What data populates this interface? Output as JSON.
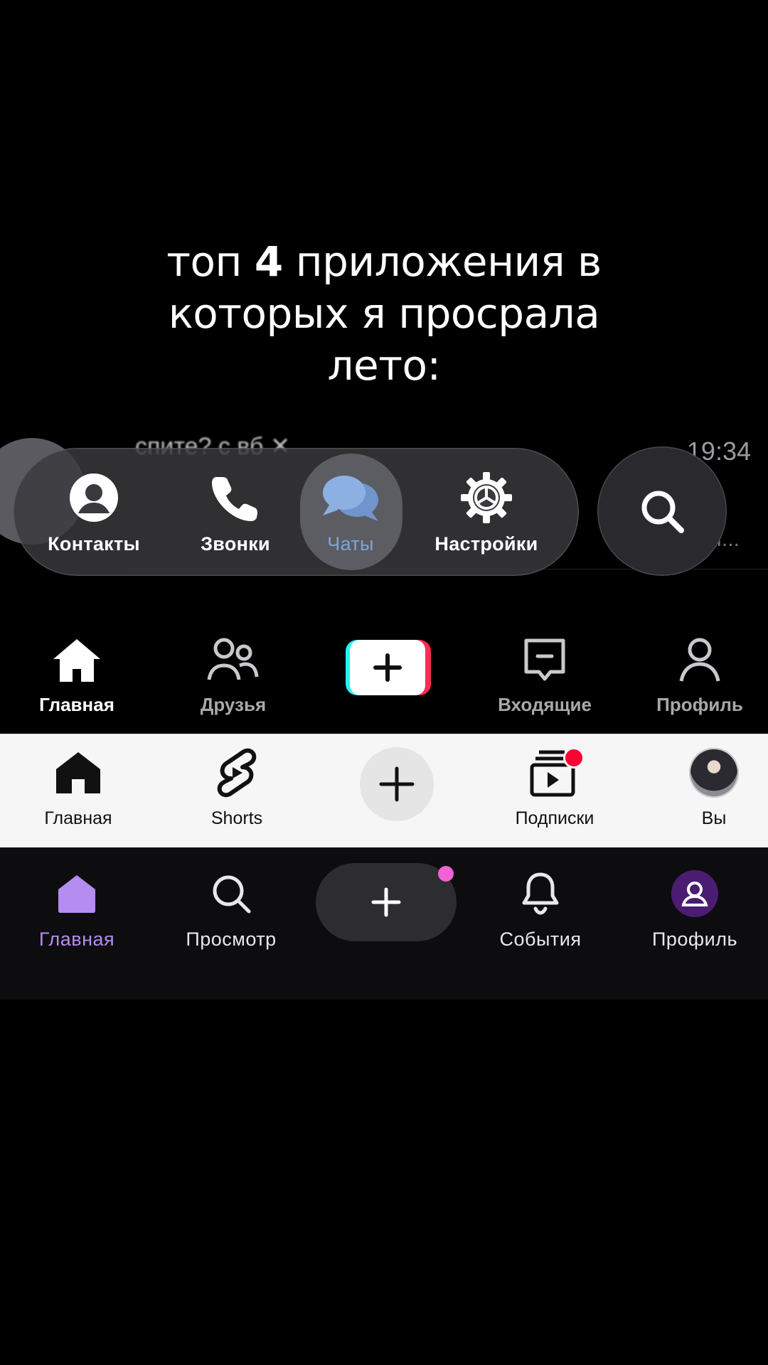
{
  "caption": {
    "line1_pre": "топ",
    "line1_num": "4",
    "line1_post": "приложения в",
    "line2": "которых я просрала",
    "line3": "лето:"
  },
  "telegram": {
    "background_chat": {
      "name": "спите? с вб ✕",
      "time": "19:34",
      "snippet": "... М..."
    },
    "tabs": [
      {
        "label": "Контакты",
        "icon": "person-circle-icon",
        "active": false
      },
      {
        "label": "Звонки",
        "icon": "phone-icon",
        "active": false
      },
      {
        "label": "Чаты",
        "icon": "chat-bubbles-icon",
        "active": true
      },
      {
        "label": "Настройки",
        "icon": "gear-icon",
        "active": false
      }
    ],
    "search_icon": "search-icon",
    "accent_color": "#7fa4d9"
  },
  "tiktok": {
    "tabs": [
      {
        "label": "Главная",
        "icon": "home-icon",
        "active": true
      },
      {
        "label": "Друзья",
        "icon": "friends-icon",
        "active": false
      },
      {
        "label": "Входящие",
        "icon": "inbox-icon",
        "active": false
      },
      {
        "label": "Профиль",
        "icon": "profile-icon",
        "active": false
      }
    ],
    "create_icon": "plus-icon",
    "colors": {
      "cyan": "#25f4ee",
      "red": "#fe2c55"
    }
  },
  "youtube": {
    "tabs": [
      {
        "label": "Главная",
        "icon": "home-icon"
      },
      {
        "label": "Shorts",
        "icon": "shorts-icon"
      },
      {
        "label": "Подписки",
        "icon": "subscriptions-icon",
        "notification": true
      },
      {
        "label": "Вы",
        "icon": "avatar-icon"
      }
    ],
    "create_icon": "plus-icon",
    "notification_color": "#ff0033"
  },
  "threads": {
    "tabs": [
      {
        "label": "Главная",
        "icon": "home-icon",
        "active": true
      },
      {
        "label": "Просмотр",
        "icon": "search-icon",
        "active": false
      },
      {
        "label": "События",
        "icon": "bell-icon",
        "active": false
      },
      {
        "label": "Профиль",
        "icon": "profile-icon",
        "active": false
      }
    ],
    "create_icon": "plus-icon",
    "accent_color": "#b58cf0",
    "dot_color": "#f062d6"
  }
}
